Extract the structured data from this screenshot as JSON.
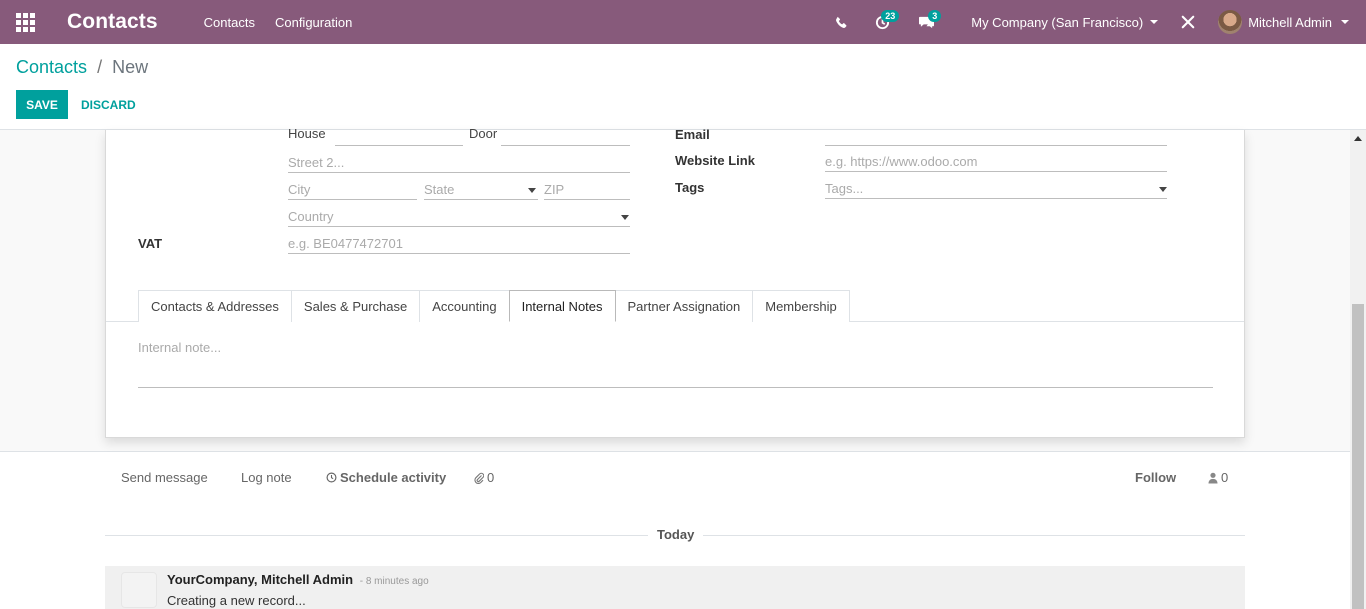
{
  "navbar": {
    "brand": "Contacts",
    "menus": [
      "Contacts",
      "Configuration"
    ],
    "activity_count": "23",
    "message_count": "3",
    "company": "My Company (San Francisco)",
    "user": "Mitchell Admin",
    "color": "#875a7b"
  },
  "breadcrumb": {
    "parent": "Contacts",
    "separator": "/",
    "current": "New"
  },
  "buttons": {
    "save": "SAVE",
    "discard": "DISCARD"
  },
  "form": {
    "address": {
      "house_label": "House",
      "door_label": "Door",
      "street2_placeholder": "Street 2...",
      "city_placeholder": "City",
      "state_placeholder": "State",
      "zip_placeholder": "ZIP",
      "country_placeholder": "Country"
    },
    "vat_label": "VAT",
    "vat_placeholder": "e.g. BE0477472701",
    "email_label": "Email",
    "website_label": "Website Link",
    "website_placeholder": "e.g. https://www.odoo.com",
    "tags_label": "Tags",
    "tags_placeholder": "Tags..."
  },
  "tabs": [
    "Contacts & Addresses",
    "Sales & Purchase",
    "Accounting",
    "Internal Notes",
    "Partner Assignation",
    "Membership"
  ],
  "active_tab": "Internal Notes",
  "internal_note_placeholder": "Internal note...",
  "chatter": {
    "send_message": "Send message",
    "log_note": "Log note",
    "schedule_activity": "Schedule activity",
    "attachments": "0",
    "follow": "Follow",
    "followers": "0",
    "date_separator": "Today",
    "message": {
      "author": "YourCompany, Mitchell Admin",
      "time": "- 8 minutes ago",
      "body": "Creating a new record..."
    }
  },
  "colors": {
    "accent": "#00a09d",
    "brand": "#875a7b"
  }
}
